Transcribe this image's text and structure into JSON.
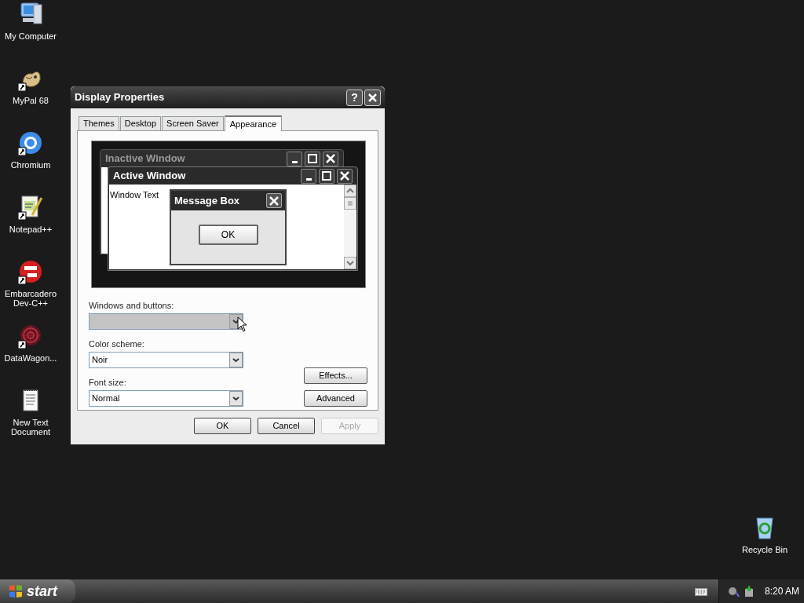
{
  "desktop_icons": [
    {
      "label": "My Computer",
      "kind": "computer",
      "shortcut": false
    },
    {
      "label": "MyPal 68",
      "kind": "animal",
      "shortcut": true
    },
    {
      "label": "Chromium",
      "kind": "browser",
      "shortcut": true
    },
    {
      "label": "Notepad++",
      "kind": "editor",
      "shortcut": true
    },
    {
      "label": "Embarcadero Dev-C++",
      "kind": "ide",
      "shortcut": true
    },
    {
      "label": "DataWagon...",
      "kind": "pattern",
      "shortcut": true
    },
    {
      "label": "New Text Document",
      "kind": "textfile",
      "shortcut": false
    }
  ],
  "recycle_bin": {
    "label": "Recycle Bin"
  },
  "dialog": {
    "title": "Display Properties",
    "help_label": "?",
    "tabs": [
      {
        "label": "Themes",
        "selected": false
      },
      {
        "label": "Desktop",
        "selected": false
      },
      {
        "label": "Screen Saver",
        "selected": false
      },
      {
        "label": "Appearance",
        "selected": true
      }
    ],
    "preview": {
      "inactive_title": "Inactive Window",
      "active_title": "Active Window",
      "window_text": "Window Text",
      "message_title": "Message Box",
      "message_button": "OK"
    },
    "fields": [
      {
        "label": "Windows and buttons:",
        "disabled": true
      },
      {
        "label": "Color scheme:",
        "value": "Noir",
        "disabled": false
      },
      {
        "label": "Font size:",
        "value": "Normal",
        "disabled": false
      }
    ],
    "side_buttons": [
      "Effects...",
      "Advanced"
    ],
    "buttons": [
      {
        "label": "OK",
        "disabled": false
      },
      {
        "label": "Cancel",
        "disabled": false
      },
      {
        "label": "Apply",
        "disabled": true
      }
    ]
  },
  "taskbar": {
    "start_label": "start",
    "clock": "8:20 AM"
  }
}
